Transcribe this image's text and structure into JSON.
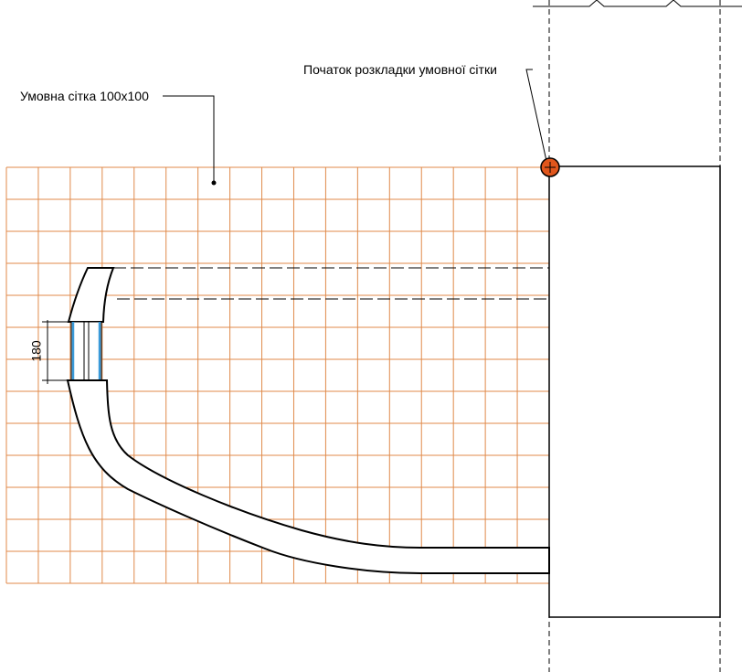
{
  "labels": {
    "grid_label": "Умовна сітка 100x100",
    "origin_label": "Початок розкладки умовної сітки",
    "dimension_value": "180"
  },
  "grid": {
    "cell_size_mm": 100,
    "columns": 17,
    "rows": 13
  },
  "colors": {
    "grid_line": "#e08a4a",
    "origin_marker": "#e0561c",
    "glass_edge": "#3a9ad9",
    "outline": "#000000"
  }
}
